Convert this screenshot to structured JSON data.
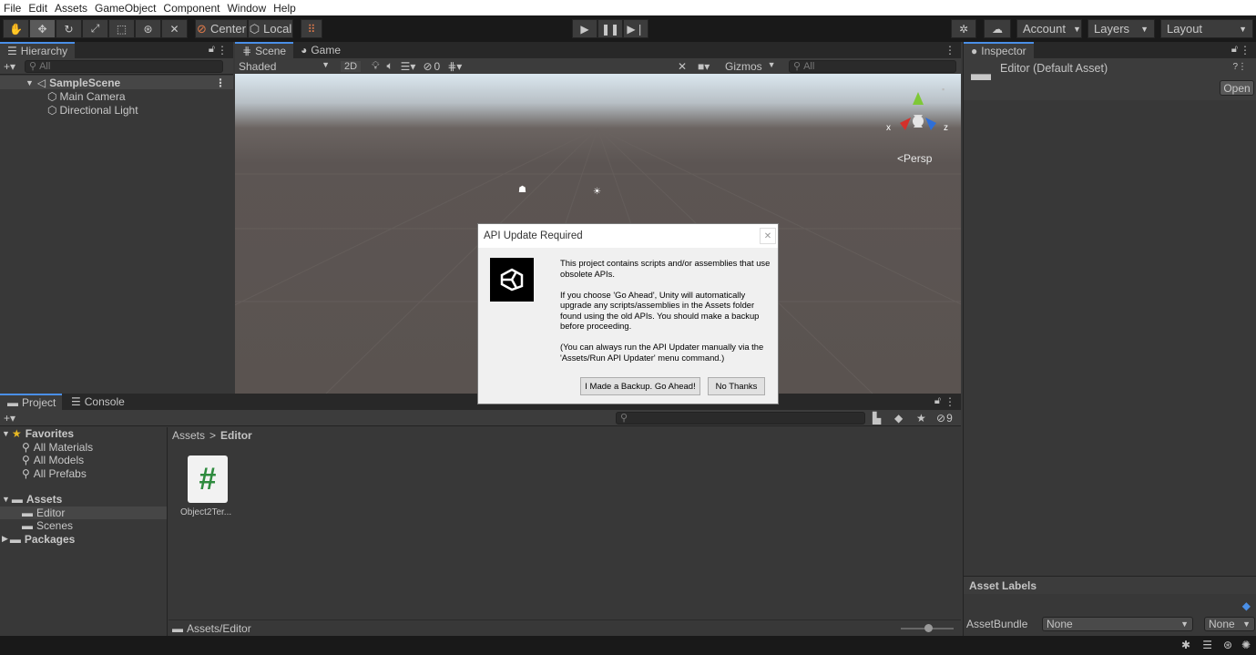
{
  "menu": [
    "File",
    "Edit",
    "Assets",
    "GameObject",
    "Component",
    "Window",
    "Help"
  ],
  "toolbar": {
    "pivot_label": "Center",
    "space_label": "Local",
    "account_label": "Account",
    "layers_label": "Layers",
    "layout_label": "Layout"
  },
  "hierarchy": {
    "tab_label": "Hierarchy",
    "search_placeholder": "All",
    "scene_name": "SampleScene",
    "items": [
      "Main Camera",
      "Directional Light"
    ]
  },
  "scene": {
    "tabs": [
      "Scene",
      "Game"
    ],
    "shading_mode": "Shaded",
    "mode_2d": "2D",
    "hidden_count": "0",
    "gizmos_label": "Gizmos",
    "search_placeholder": "All",
    "persp_label": "Persp",
    "axis_x": "x",
    "axis_z": "z"
  },
  "dialog": {
    "title": "API Update Required",
    "paragraphs": [
      "This project contains scripts and/or assemblies that use obsolete APIs.",
      "If you choose 'Go Ahead', Unity will automatically upgrade any scripts/assemblies in the Assets folder found using the old APIs. You should make a backup before proceeding.",
      "(You can always run the API Updater manually via the 'Assets/Run API Updater' menu command.)"
    ],
    "primary_button": "I Made a Backup. Go Ahead!",
    "secondary_button": "No Thanks"
  },
  "project": {
    "tabs": [
      "Project",
      "Console"
    ],
    "hidden_count": "9",
    "favorites_label": "Favorites",
    "favorites": [
      "All Materials",
      "All Models",
      "All Prefabs"
    ],
    "assets_label": "Assets",
    "asset_folders": [
      "Editor",
      "Scenes"
    ],
    "packages_label": "Packages",
    "breadcrumb_root": "Assets",
    "breadcrumb_current": "Editor",
    "file_name": "Object2Ter...",
    "file_glyph": "#",
    "footer_path": "Assets/Editor"
  },
  "inspector": {
    "tab_label": "Inspector",
    "object_title": "Editor (Default Asset)",
    "open_button": "Open",
    "asset_labels": "Asset Labels",
    "asset_bundle_label": "AssetBundle",
    "asset_bundle_value": "None",
    "variant_value": "None"
  },
  "colors": {
    "accent_tab": "#4a8fe7",
    "panel_bg": "#383838",
    "toolbar_bg": "#191919",
    "csharp_green": "#2e8b3e"
  }
}
